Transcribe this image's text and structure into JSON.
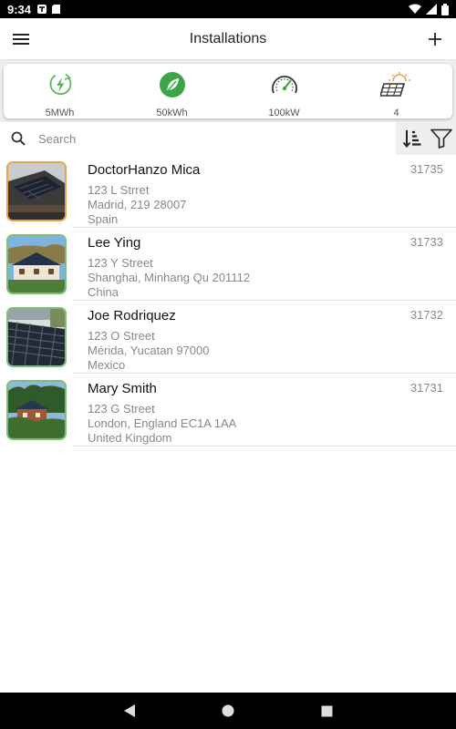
{
  "status_bar": {
    "time": "9:34"
  },
  "app_bar": {
    "title": "Installations"
  },
  "summary": [
    {
      "icon": "energy-bolt-icon",
      "value": "5MWh"
    },
    {
      "icon": "leaf-icon",
      "value": "50kWh"
    },
    {
      "icon": "speedometer-icon",
      "value": "100kW"
    },
    {
      "icon": "solar-panel-sun-icon",
      "value": "4"
    }
  ],
  "search": {
    "placeholder": "Search",
    "value": ""
  },
  "installations": [
    {
      "name": "DoctorHanzo Mica",
      "id": "31735",
      "address_line1": "123 L Strret",
      "address_line2": "Madrid, 219 28007",
      "country": "Spain",
      "thumb_border": "#e8a24a"
    },
    {
      "name": "Lee Ying",
      "id": "31733",
      "address_line1": "123 Y Street",
      "address_line2": "Shanghai, Minhang Qu 201112",
      "country": "China",
      "thumb_border": "#7dbf7a"
    },
    {
      "name": "Joe Rodriquez",
      "id": "31732",
      "address_line1": "123 O Street",
      "address_line2": "Mérida, Yucatan 97000",
      "country": "Mexico",
      "thumb_border": "#7dbf7a"
    },
    {
      "name": "Mary Smith",
      "id": "31731",
      "address_line1": "123 G Street",
      "address_line2": "London, England EC1A 1AA",
      "country": "United Kingdom",
      "thumb_border": "#7dbf7a"
    }
  ],
  "colors": {
    "accent_green": "#3aa648",
    "energy_green": "#5bb85a"
  }
}
